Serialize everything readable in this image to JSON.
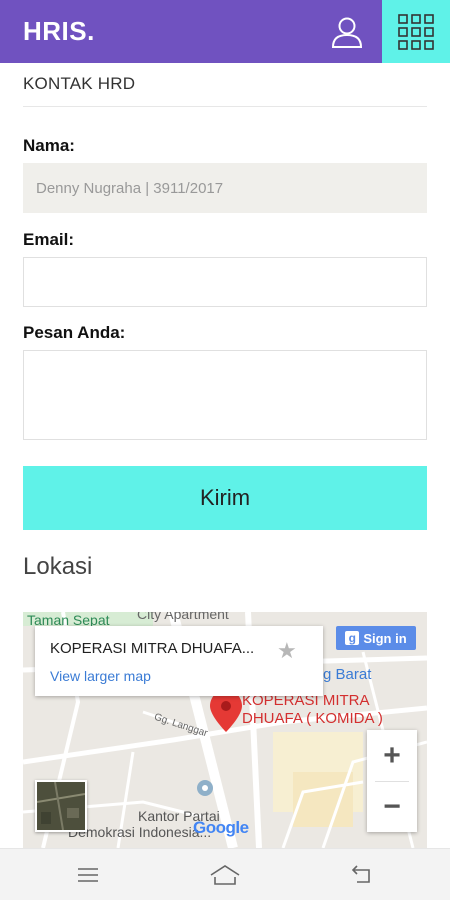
{
  "header": {
    "brand": "HRIS.",
    "user_icon": "user-icon",
    "menu_icon": "grid-menu-icon",
    "accent_color": "#7052c0",
    "highlight_color": "#5ff2e8"
  },
  "section": {
    "title": "KONTAK HRD"
  },
  "form": {
    "name_label": "Nama:",
    "name_value": "Denny Nugraha | 3911/2017",
    "email_label": "Email:",
    "email_value": "",
    "message_label": "Pesan Anda:",
    "message_value": "",
    "submit_label": "Kirim"
  },
  "location": {
    "title": "Lokasi",
    "map": {
      "place_title": "KOPERASI MITRA DHUAFA...",
      "view_larger": "View larger map",
      "signin_label": "Sign in",
      "marker_label_line1": "KOPERASI MITRA",
      "marker_label_line2": "DHUAFA ( KOMIDA )",
      "labels": {
        "taman_sepat": "Taman Sepat",
        "city_apartment": "City Apartment",
        "barat": "g Barat",
        "gg_langgar": "Gg. Langgar",
        "kantor_partai": "Kantor Partai",
        "demokrasi": "Demokrasi Indonesia..."
      },
      "zoom_in": "+",
      "zoom_out": "−",
      "provider": "Google"
    }
  },
  "navbar": {
    "menu_icon": "hamburger-icon",
    "home_icon": "home-icon",
    "back_icon": "back-icon"
  }
}
